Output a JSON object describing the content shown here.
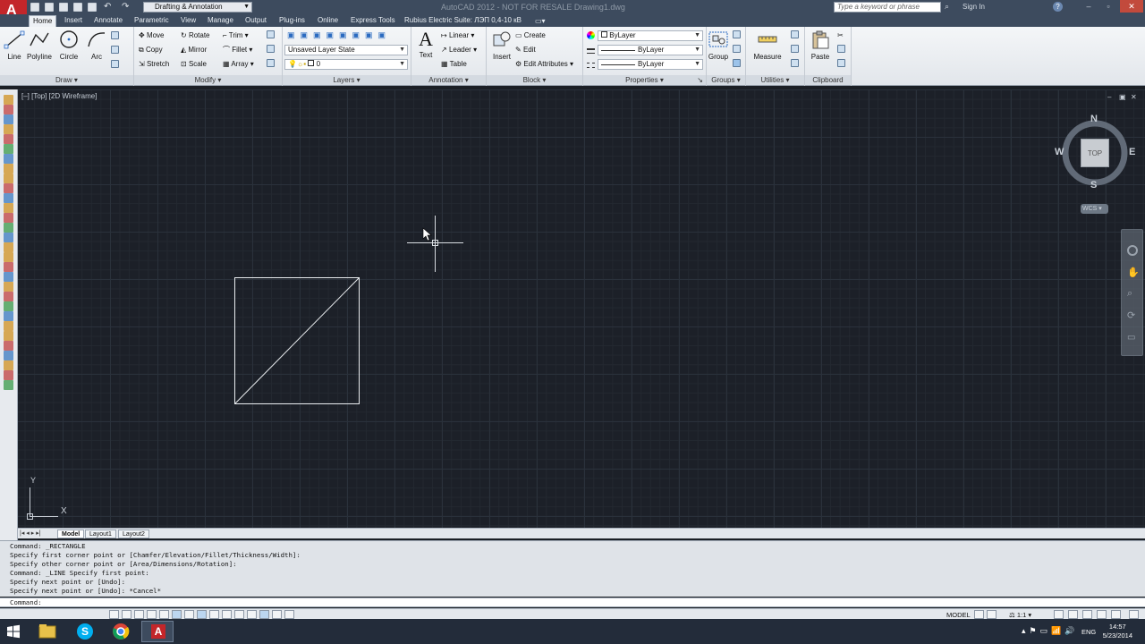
{
  "titlebar": {
    "workspace": "Drafting & Annotation",
    "title": "AutoCAD 2012 - NOT FOR RESALE    Drawing1.dwg",
    "search_placeholder": "Type a keyword or phrase",
    "signin": "Sign In"
  },
  "tabs": [
    "Home",
    "Insert",
    "Annotate",
    "Parametric",
    "View",
    "Manage",
    "Output",
    "Plug-ins",
    "Online",
    "Express Tools",
    "Rubius Electric Suite: ЛЭП 0,4-10 кВ"
  ],
  "ribbon": {
    "draw": {
      "title": "Draw",
      "line": "Line",
      "polyline": "Polyline",
      "circle": "Circle",
      "arc": "Arc"
    },
    "modify": {
      "title": "Modify",
      "move": "Move",
      "rotate": "Rotate",
      "trim": "Trim",
      "copy": "Copy",
      "mirror": "Mirror",
      "fillet": "Fillet",
      "stretch": "Stretch",
      "scale": "Scale",
      "array": "Array"
    },
    "layers": {
      "title": "Layers",
      "layer_state": "Unsaved Layer State",
      "current_layer": "0"
    },
    "annotation": {
      "title": "Annotation",
      "text": "Text",
      "linear": "Linear",
      "leader": "Leader",
      "table": "Table"
    },
    "block": {
      "title": "Block",
      "insert": "Insert",
      "create": "Create",
      "edit": "Edit",
      "edit_attributes": "Edit Attributes"
    },
    "properties": {
      "title": "Properties",
      "color": "ByLayer",
      "linetype": "ByLayer",
      "lineweight": "ByLayer"
    },
    "groups": {
      "title": "Groups",
      "group": "Group"
    },
    "utilities": {
      "title": "Utilities",
      "measure": "Measure"
    },
    "clipboard": {
      "title": "Clipboard",
      "paste": "Paste"
    }
  },
  "viewport": {
    "label": "[–] [Top] [2D Wireframe]",
    "viewcube": {
      "north": "N",
      "south": "S",
      "east": "E",
      "west": "W",
      "face": "TOP",
      "wcs": "WCS"
    },
    "ucs": {
      "x": "X",
      "y": "Y"
    }
  },
  "layout_tabs": [
    "Model",
    "Layout1",
    "Layout2"
  ],
  "command_history": [
    "Command: _RECTANGLE",
    "Specify first corner point or [Chamfer/Elevation/Fillet/Thickness/Width]:",
    "Specify other corner point or [Area/Dimensions/Rotation]:",
    "Command: _LINE Specify first point:",
    "Specify next point or [Undo]:",
    "Specify next point or [Undo]: *Cancel*"
  ],
  "command_prompt": "Command:",
  "statusbar": {
    "model": "MODEL",
    "scale": "1:1"
  },
  "taskbar": {
    "lang": "ENG",
    "time": "14:57",
    "date": "5/23/2014"
  },
  "colors": {
    "canvas": "#1c2028",
    "accent": "#c3262a",
    "titlebar": "#3d4b5e"
  }
}
